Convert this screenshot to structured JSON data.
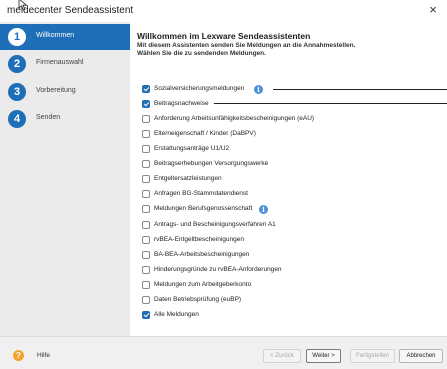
{
  "window": {
    "title": "meldecenter Sendeassistent",
    "close_label": "×"
  },
  "sidebar": {
    "steps": [
      {
        "number": "1",
        "label": "Willkommen",
        "active": true
      },
      {
        "number": "2",
        "label": "Firmenauswahl",
        "active": false
      },
      {
        "number": "3",
        "label": "Vorbereitung",
        "active": false
      },
      {
        "number": "4",
        "label": "Senden",
        "active": false
      }
    ]
  },
  "main": {
    "heading": "Willkommen im Lexware Sendeassistenten",
    "subtext_1": "Mit diesem Assistenten senden Sie Meldungen an die Annahmestellen.",
    "subtext_2": "Wählen Sie die zu sendenden Meldungen.",
    "options": [
      {
        "label": "Sozialversicherungsmeldungen",
        "checked": true
      },
      {
        "label": "Beitragsnachweise",
        "checked": true
      },
      {
        "label": "Anforderung Arbeitsunfähigkeitsbescheinigungen (eAU)",
        "checked": false
      },
      {
        "label": "Elterneigenschaft / Kinder (DaBPV)",
        "checked": false
      },
      {
        "label": "Erstattungsanträge U1/U2",
        "checked": false
      },
      {
        "label": "Beitragserhebungen Versorgungswerke",
        "checked": false
      },
      {
        "label": "Entgeltersatzleistungen",
        "checked": false
      },
      {
        "label": "Anfragen BG-Stammdatendienst",
        "checked": false
      },
      {
        "label": "Meldungen Berufsgenossenschaft",
        "checked": false
      },
      {
        "label": "Antrags- und Bescheinigungsverfahren A1",
        "checked": false
      },
      {
        "label": "rvBEA-Entgeltbescheinigungen",
        "checked": false
      },
      {
        "label": "BA-BEA-Arbeitsbescheinigungen",
        "checked": false
      },
      {
        "label": "Hinderungsgründe zu rvBEA-Anforderungen",
        "checked": false
      },
      {
        "label": "Meldungen zum Arbeitgeberkonto",
        "checked": false
      },
      {
        "label": "Daten Betriebsprüfung (euBP)",
        "checked": false
      },
      {
        "label": "Alle Meldungen",
        "checked": true
      }
    ]
  },
  "footer": {
    "help_label": "Hilfe",
    "back_label": "< Zurück",
    "next_label": "Weiter >",
    "finish_label": "Fertigstellen",
    "cancel_label": "Abbrechen"
  },
  "colors": {
    "accent": "#1f6fb8",
    "sidebar_bg": "#ebebeb",
    "info_icon": "#4a90d9",
    "help_icon": "#f2a32b"
  },
  "icons": {
    "help": "help-icon",
    "info": "info-icon",
    "close": "close-icon"
  }
}
